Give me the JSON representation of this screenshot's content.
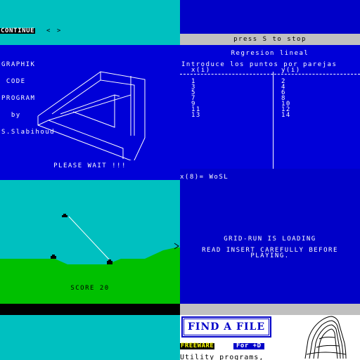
{
  "top_left": {
    "continue_label": "CONTINUE",
    "arrows": "< >"
  },
  "top_right": {
    "stop_prompt": "press S to stop"
  },
  "graphik": {
    "lines": [
      "GRAPHIK",
      " CODE",
      "PROGRAM",
      "  by",
      "S.Slabihoud"
    ],
    "status": "PLEASE WAIT !!!"
  },
  "regression": {
    "title": "Regresion lineal",
    "subtitle": "Introduce los puntos por parejas",
    "x_header": "x(i)",
    "y_header": "y(i)",
    "x_values": [
      "1",
      "3",
      "5",
      "7",
      "9",
      "11",
      "13"
    ],
    "y_values": [
      "2",
      "4",
      "6",
      "8",
      "10",
      "12",
      "14"
    ]
  },
  "game": {
    "score_label": "SCORE 20"
  },
  "loader": {
    "prompt": "x(8)= WoSL",
    "title": "GRID-RUN IS LOADING",
    "line1": "READ INSERT CAREFULLY BEFORE",
    "line2": "PLAYING."
  },
  "find_a_file": {
    "title": "FIND A FILE",
    "freeware": "FREEWARE",
    "platform": "For +D",
    "description": "Utility programs,"
  },
  "colors": {
    "spectrum_blue": "#0000d8",
    "spectrum_cyan": "#00c0c0",
    "spectrum_green": "#00c000",
    "spectrum_grey": "#c0c0c0"
  }
}
